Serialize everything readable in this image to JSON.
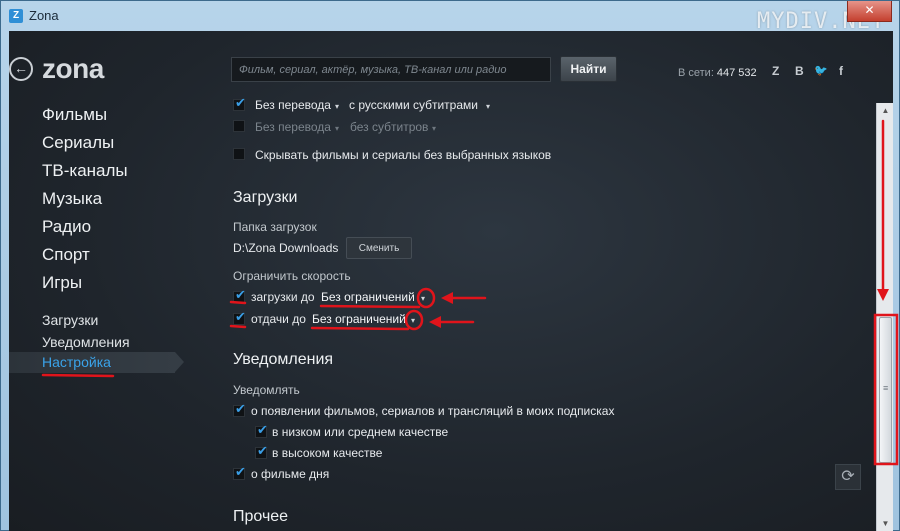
{
  "window": {
    "title": "Zona",
    "badge": "Z",
    "watermark": "MYDIV.NET",
    "close_glyph": "✕"
  },
  "header": {
    "logo": "zona",
    "back_glyph": "←",
    "search_placeholder": "Фильм, сериал, актёр, музыка, ТВ-канал или радио",
    "search_button": "Найти",
    "online_label": "В сети:",
    "online_count": "447 532",
    "social": [
      {
        "label": "Z",
        "icon": "zona-icon"
      },
      {
        "label": "B",
        "icon": "vk-icon"
      },
      {
        "label": "🐦",
        "icon": "twitter-icon"
      },
      {
        "label": "f",
        "icon": "facebook-icon"
      }
    ]
  },
  "nav": {
    "main": [
      "Фильмы",
      "Сериалы",
      "ТВ-каналы",
      "Музыка",
      "Радио",
      "Спорт",
      "Игры"
    ],
    "sub": [
      "Загрузки",
      "Уведомления",
      "Настройка"
    ],
    "active": "Настройка"
  },
  "settings": {
    "languages": {
      "row1_left": "Без перевода",
      "row1_right": "с русскими субтитрами",
      "row2_left": "Без перевода",
      "row2_right": "без субтитров",
      "hide_label": "Скрывать фильмы и сериалы без выбранных языков"
    },
    "downloads": {
      "title": "Загрузки",
      "folder_label": "Папка загрузок",
      "folder_path": "D:\\Zona Downloads",
      "change_button": "Сменить",
      "limit_label": "Ограничить скорость",
      "download_label": "загрузки до",
      "download_value": "Без ограничений",
      "upload_label": "отдачи до",
      "upload_value": "Без ограничений"
    },
    "notifications": {
      "title": "Уведомления",
      "notify_label": "Уведомлять",
      "new_items": "о появлении фильмов, сериалов и трансляций в моих подписках",
      "low_quality": "в низком или среднем качестве",
      "high_quality": "в высоком качестве",
      "film_of_day": "о фильме дня"
    },
    "other": {
      "title": "Прочее"
    }
  },
  "colors": {
    "accent": "#3aa3ea",
    "annotation": "#e0141b"
  }
}
